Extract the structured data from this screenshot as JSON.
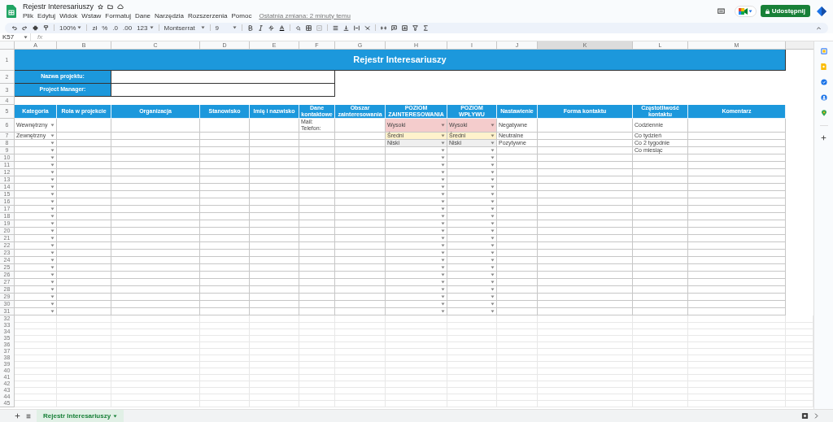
{
  "app": {
    "title": "Rejestr Interesariuszy",
    "menu": [
      "Plik",
      "Edytuj",
      "Widok",
      "Wstaw",
      "Formatuj",
      "Dane",
      "Narzędzia",
      "Rozszerzenia",
      "Pomoc"
    ],
    "last_edit": "Ostatnia zmiana: 2 minuty temu",
    "share_button": "Udostępnij"
  },
  "toolbar": {
    "zoom": "100%",
    "currency": "zł",
    "percent": "%",
    "decrease_decimals": ".0",
    "increase_decimals": ".00",
    "number_format": "123",
    "font": "Montserrat",
    "font_size": "9"
  },
  "formula_bar": {
    "cell": "K57",
    "fx": "fx"
  },
  "columns": [
    {
      "letter": "A",
      "selected": false
    },
    {
      "letter": "B",
      "selected": false
    },
    {
      "letter": "C",
      "selected": false
    },
    {
      "letter": "D",
      "selected": false
    },
    {
      "letter": "E",
      "selected": false
    },
    {
      "letter": "F",
      "selected": false
    },
    {
      "letter": "G",
      "selected": false
    },
    {
      "letter": "H",
      "selected": false
    },
    {
      "letter": "I",
      "selected": false
    },
    {
      "letter": "J",
      "selected": false
    },
    {
      "letter": "K",
      "selected": true
    },
    {
      "letter": "L",
      "selected": false
    },
    {
      "letter": "M",
      "selected": false
    }
  ],
  "sheet": {
    "title_row": "1",
    "title": "Rejestr Interesariuszy",
    "fields": [
      {
        "row": "2",
        "label": "Nazwa projektu:"
      },
      {
        "row": "3",
        "label": "Project Manager:"
      }
    ],
    "spacer_row": "4",
    "header_row": "5",
    "headers": [
      {
        "label": "Kategoria",
        "dropdown": true
      },
      {
        "label": "Rola w projekcie",
        "dropdown": false
      },
      {
        "label": "Organizacja",
        "dropdown": false
      },
      {
        "label": "Stanowisko",
        "dropdown": false
      },
      {
        "label": "Imię i nazwisko",
        "dropdown": false
      },
      {
        "label": "Dane kontaktowe",
        "dropdown": false
      },
      {
        "label": "Obszar zainteresowania",
        "dropdown": false
      },
      {
        "label": "POZIOM ZAINTERESOWANIA",
        "dropdown": true
      },
      {
        "label": "POZIOM WPŁYWU",
        "dropdown": true
      },
      {
        "label": "Nastawienie",
        "dropdown": false
      },
      {
        "label": "Forma kontaktu",
        "dropdown": false
      },
      {
        "label": "Częstotliwość kontaktu",
        "dropdown": false
      },
      {
        "label": "Komentarz",
        "dropdown": false
      }
    ],
    "rows": [
      {
        "number": "6",
        "cells": {
          "A": {
            "text": "Wewnętrzny"
          },
          "F": {
            "text": "Mail:\nTelefon:"
          },
          "H": {
            "text": "Wysoki",
            "color": "#f4cccc"
          },
          "I": {
            "text": "Wysoki",
            "color": "#f4cccc"
          },
          "J": {
            "text": "Negatywne"
          },
          "L": {
            "text": "Codziennie"
          }
        }
      },
      {
        "number": "7",
        "cells": {
          "A": {
            "text": "Zewnętrzny"
          },
          "H": {
            "text": "Średni",
            "color": "#fff2cc"
          },
          "I": {
            "text": "Średni",
            "color": "#fff2cc"
          },
          "J": {
            "text": "Neutralne"
          },
          "L": {
            "text": "Co tydzień"
          }
        }
      },
      {
        "number": "8",
        "cells": {
          "H": {
            "text": "Niski",
            "color": "#efefef"
          },
          "I": {
            "text": "Niski",
            "color": "#efefef"
          },
          "J": {
            "text": "Pozytywne"
          },
          "L": {
            "text": "Co 2 tygodnie"
          }
        }
      },
      {
        "number": "9",
        "cells": {
          "L": {
            "text": "Co miesiąc"
          }
        }
      },
      {
        "number": "10",
        "cells": {}
      },
      {
        "number": "11",
        "cells": {}
      },
      {
        "number": "12",
        "cells": {}
      },
      {
        "number": "13",
        "cells": {}
      },
      {
        "number": "14",
        "cells": {}
      },
      {
        "number": "15",
        "cells": {}
      },
      {
        "number": "16",
        "cells": {}
      },
      {
        "number": "17",
        "cells": {}
      },
      {
        "number": "18",
        "cells": {}
      },
      {
        "number": "19",
        "cells": {}
      },
      {
        "number": "20",
        "cells": {}
      },
      {
        "number": "21",
        "cells": {}
      },
      {
        "number": "22",
        "cells": {}
      },
      {
        "number": "23",
        "cells": {}
      },
      {
        "number": "24",
        "cells": {}
      },
      {
        "number": "25",
        "cells": {}
      },
      {
        "number": "26",
        "cells": {}
      },
      {
        "number": "27",
        "cells": {}
      },
      {
        "number": "28",
        "cells": {}
      },
      {
        "number": "29",
        "cells": {}
      },
      {
        "number": "30",
        "cells": {}
      },
      {
        "number": "31",
        "cells": {}
      }
    ],
    "empty_rows": [
      "32",
      "33",
      "34",
      "35",
      "36",
      "37",
      "38",
      "39",
      "40",
      "41",
      "42",
      "43",
      "44",
      "45"
    ]
  },
  "sheet_tabs": [
    {
      "label": "Rejestr Interesariuszy",
      "selected": true
    }
  ]
}
